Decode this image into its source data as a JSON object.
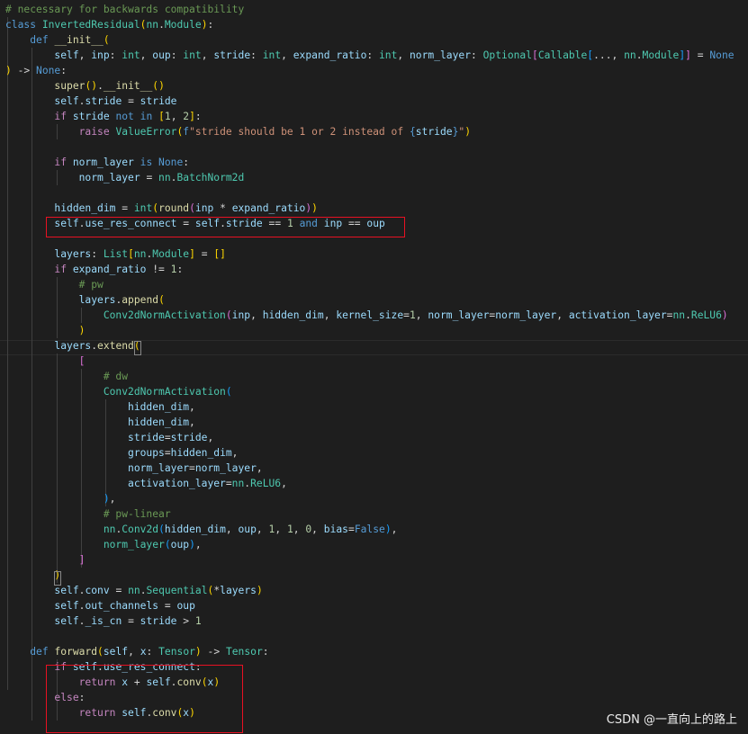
{
  "editor": {
    "colors": {
      "background": "#1e1e1e",
      "highlight_box": "#e81123",
      "keyword": "#569cd6",
      "control": "#c586c0",
      "function": "#dcdcaa",
      "class": "#4ec9b0",
      "variable": "#9cdcfe",
      "number": "#b5cea8",
      "string": "#ce9178",
      "comment": "#6a9955"
    },
    "lines": [
      [
        [
          "t-cmt",
          "# necessary for backwards compatibility"
        ]
      ],
      [
        [
          "t-kw",
          "class "
        ],
        [
          "t-cls",
          "InvertedResidual"
        ],
        [
          "t-p1",
          "("
        ],
        [
          "t-cls",
          "nn"
        ],
        [
          "t-op",
          "."
        ],
        [
          "t-cls",
          "Module"
        ],
        [
          "t-p1",
          ")"
        ],
        [
          "t-op",
          ":"
        ]
      ],
      [
        [
          "t-op",
          "    "
        ],
        [
          "t-kw",
          "def "
        ],
        [
          "t-fn",
          "__init__"
        ],
        [
          "t-p1",
          "("
        ]
      ],
      [
        [
          "t-op",
          "        "
        ],
        [
          "t-var",
          "self"
        ],
        [
          "t-op",
          ", "
        ],
        [
          "t-var",
          "inp"
        ],
        [
          "t-op",
          ": "
        ],
        [
          "t-cls",
          "int"
        ],
        [
          "t-op",
          ", "
        ],
        [
          "t-var",
          "oup"
        ],
        [
          "t-op",
          ": "
        ],
        [
          "t-cls",
          "int"
        ],
        [
          "t-op",
          ", "
        ],
        [
          "t-var",
          "stride"
        ],
        [
          "t-op",
          ": "
        ],
        [
          "t-cls",
          "int"
        ],
        [
          "t-op",
          ", "
        ],
        [
          "t-var",
          "expand_ratio"
        ],
        [
          "t-op",
          ": "
        ],
        [
          "t-cls",
          "int"
        ],
        [
          "t-op",
          ", "
        ],
        [
          "t-var",
          "norm_layer"
        ],
        [
          "t-op",
          ": "
        ],
        [
          "t-cls",
          "Optional"
        ],
        [
          "t-p2",
          "["
        ],
        [
          "t-cls",
          "Callable"
        ],
        [
          "t-p3",
          "["
        ],
        [
          "t-op",
          "..., "
        ],
        [
          "t-cls",
          "nn"
        ],
        [
          "t-op",
          "."
        ],
        [
          "t-cls",
          "Module"
        ],
        [
          "t-p3",
          "]"
        ],
        [
          "t-p2",
          "]"
        ],
        [
          "t-op",
          " = "
        ],
        [
          "t-kw",
          "None"
        ]
      ],
      [
        [
          "t-p1",
          ")"
        ],
        [
          "t-op",
          " -> "
        ],
        [
          "t-kw",
          "None"
        ],
        [
          "t-op",
          ":"
        ]
      ],
      [
        [
          "t-op",
          "        "
        ],
        [
          "t-fn",
          "super"
        ],
        [
          "t-p1",
          "("
        ],
        [
          "t-p1",
          ")"
        ],
        [
          "t-op",
          "."
        ],
        [
          "t-fn",
          "__init__"
        ],
        [
          "t-p1",
          "("
        ],
        [
          "t-p1",
          ")"
        ]
      ],
      [
        [
          "t-op",
          "        "
        ],
        [
          "t-var",
          "self"
        ],
        [
          "t-op",
          "."
        ],
        [
          "t-var",
          "stride"
        ],
        [
          "t-op",
          " = "
        ],
        [
          "t-var",
          "stride"
        ]
      ],
      [
        [
          "t-op",
          "        "
        ],
        [
          "t-ctl",
          "if "
        ],
        [
          "t-var",
          "stride"
        ],
        [
          "t-kw",
          " not in "
        ],
        [
          "t-p1",
          "["
        ],
        [
          "t-num",
          "1"
        ],
        [
          "t-op",
          ", "
        ],
        [
          "t-num",
          "2"
        ],
        [
          "t-p1",
          "]"
        ],
        [
          "t-op",
          ":"
        ]
      ],
      [
        [
          "t-op",
          "            "
        ],
        [
          "t-ctl",
          "raise "
        ],
        [
          "t-cls",
          "ValueError"
        ],
        [
          "t-p1",
          "("
        ],
        [
          "t-kw",
          "f"
        ],
        [
          "t-str",
          "\"stride should be 1 or 2 instead of "
        ],
        [
          "t-kw",
          "{"
        ],
        [
          "t-var",
          "stride"
        ],
        [
          "t-kw",
          "}"
        ],
        [
          "t-str",
          "\""
        ],
        [
          "t-p1",
          ")"
        ]
      ],
      [],
      [
        [
          "t-op",
          "        "
        ],
        [
          "t-ctl",
          "if "
        ],
        [
          "t-var",
          "norm_layer"
        ],
        [
          "t-kw",
          " is None"
        ],
        [
          "t-op",
          ":"
        ]
      ],
      [
        [
          "t-op",
          "            "
        ],
        [
          "t-var",
          "norm_layer"
        ],
        [
          "t-op",
          " = "
        ],
        [
          "t-cls",
          "nn"
        ],
        [
          "t-op",
          "."
        ],
        [
          "t-cls",
          "BatchNorm2d"
        ]
      ],
      [],
      [
        [
          "t-op",
          "        "
        ],
        [
          "t-var",
          "hidden_dim"
        ],
        [
          "t-op",
          " = "
        ],
        [
          "t-cls",
          "int"
        ],
        [
          "t-p1",
          "("
        ],
        [
          "t-fn",
          "round"
        ],
        [
          "t-p2",
          "("
        ],
        [
          "t-var",
          "inp"
        ],
        [
          "t-op",
          " * "
        ],
        [
          "t-var",
          "expand_ratio"
        ],
        [
          "t-p2",
          ")"
        ],
        [
          "t-p1",
          ")"
        ]
      ],
      [
        [
          "t-op",
          "        "
        ],
        [
          "t-var",
          "self"
        ],
        [
          "t-op",
          "."
        ],
        [
          "t-var",
          "use_res_connect"
        ],
        [
          "t-op",
          " = "
        ],
        [
          "t-var",
          "self"
        ],
        [
          "t-op",
          "."
        ],
        [
          "t-var",
          "stride"
        ],
        [
          "t-op",
          " == "
        ],
        [
          "t-num",
          "1"
        ],
        [
          "t-kw",
          " and "
        ],
        [
          "t-var",
          "inp"
        ],
        [
          "t-op",
          " == "
        ],
        [
          "t-var",
          "oup"
        ]
      ],
      [],
      [
        [
          "t-op",
          "        "
        ],
        [
          "t-var",
          "layers"
        ],
        [
          "t-op",
          ": "
        ],
        [
          "t-cls",
          "List"
        ],
        [
          "t-p1",
          "["
        ],
        [
          "t-cls",
          "nn"
        ],
        [
          "t-op",
          "."
        ],
        [
          "t-cls",
          "Module"
        ],
        [
          "t-p1",
          "]"
        ],
        [
          "t-op",
          " = "
        ],
        [
          "t-p1",
          "["
        ],
        [
          "t-p1",
          "]"
        ]
      ],
      [
        [
          "t-op",
          "        "
        ],
        [
          "t-ctl",
          "if "
        ],
        [
          "t-var",
          "expand_ratio"
        ],
        [
          "t-op",
          " != "
        ],
        [
          "t-num",
          "1"
        ],
        [
          "t-op",
          ":"
        ]
      ],
      [
        [
          "t-op",
          "            "
        ],
        [
          "t-cmt",
          "# pw"
        ]
      ],
      [
        [
          "t-op",
          "            "
        ],
        [
          "t-var",
          "layers"
        ],
        [
          "t-op",
          "."
        ],
        [
          "t-fn",
          "append"
        ],
        [
          "t-p1",
          "("
        ]
      ],
      [
        [
          "t-op",
          "                "
        ],
        [
          "t-cls",
          "Conv2dNormActivation"
        ],
        [
          "t-p2",
          "("
        ],
        [
          "t-var",
          "inp"
        ],
        [
          "t-op",
          ", "
        ],
        [
          "t-var",
          "hidden_dim"
        ],
        [
          "t-op",
          ", "
        ],
        [
          "t-var",
          "kernel_size"
        ],
        [
          "t-op",
          "="
        ],
        [
          "t-num",
          "1"
        ],
        [
          "t-op",
          ", "
        ],
        [
          "t-var",
          "norm_layer"
        ],
        [
          "t-op",
          "="
        ],
        [
          "t-var",
          "norm_layer"
        ],
        [
          "t-op",
          ", "
        ],
        [
          "t-var",
          "activation_layer"
        ],
        [
          "t-op",
          "="
        ],
        [
          "t-cls",
          "nn"
        ],
        [
          "t-op",
          "."
        ],
        [
          "t-cls",
          "ReLU6"
        ],
        [
          "t-p2",
          ")"
        ]
      ],
      [
        [
          "t-op",
          "            "
        ],
        [
          "t-p1",
          ")"
        ]
      ],
      [
        [
          "t-op",
          "        "
        ],
        [
          "t-var",
          "layers"
        ],
        [
          "t-op",
          "."
        ],
        [
          "t-fn",
          "extend"
        ],
        [
          "t-p1",
          "("
        ]
      ],
      [
        [
          "t-op",
          "            "
        ],
        [
          "t-p2",
          "["
        ]
      ],
      [
        [
          "t-op",
          "                "
        ],
        [
          "t-cmt",
          "# dw"
        ]
      ],
      [
        [
          "t-op",
          "                "
        ],
        [
          "t-cls",
          "Conv2dNormActivation"
        ],
        [
          "t-p3",
          "("
        ]
      ],
      [
        [
          "t-op",
          "                    "
        ],
        [
          "t-var",
          "hidden_dim"
        ],
        [
          "t-op",
          ","
        ]
      ],
      [
        [
          "t-op",
          "                    "
        ],
        [
          "t-var",
          "hidden_dim"
        ],
        [
          "t-op",
          ","
        ]
      ],
      [
        [
          "t-op",
          "                    "
        ],
        [
          "t-var",
          "stride"
        ],
        [
          "t-op",
          "="
        ],
        [
          "t-var",
          "stride"
        ],
        [
          "t-op",
          ","
        ]
      ],
      [
        [
          "t-op",
          "                    "
        ],
        [
          "t-var",
          "groups"
        ],
        [
          "t-op",
          "="
        ],
        [
          "t-var",
          "hidden_dim"
        ],
        [
          "t-op",
          ","
        ]
      ],
      [
        [
          "t-op",
          "                    "
        ],
        [
          "t-var",
          "norm_layer"
        ],
        [
          "t-op",
          "="
        ],
        [
          "t-var",
          "norm_layer"
        ],
        [
          "t-op",
          ","
        ]
      ],
      [
        [
          "t-op",
          "                    "
        ],
        [
          "t-var",
          "activation_layer"
        ],
        [
          "t-op",
          "="
        ],
        [
          "t-cls",
          "nn"
        ],
        [
          "t-op",
          "."
        ],
        [
          "t-cls",
          "ReLU6"
        ],
        [
          "t-op",
          ","
        ]
      ],
      [
        [
          "t-op",
          "                "
        ],
        [
          "t-p3",
          ")"
        ],
        [
          "t-op",
          ","
        ]
      ],
      [
        [
          "t-op",
          "                "
        ],
        [
          "t-cmt",
          "# pw-linear"
        ]
      ],
      [
        [
          "t-op",
          "                "
        ],
        [
          "t-cls",
          "nn"
        ],
        [
          "t-op",
          "."
        ],
        [
          "t-cls",
          "Conv2d"
        ],
        [
          "t-p3",
          "("
        ],
        [
          "t-var",
          "hidden_dim"
        ],
        [
          "t-op",
          ", "
        ],
        [
          "t-var",
          "oup"
        ],
        [
          "t-op",
          ", "
        ],
        [
          "t-num",
          "1"
        ],
        [
          "t-op",
          ", "
        ],
        [
          "t-num",
          "1"
        ],
        [
          "t-op",
          ", "
        ],
        [
          "t-num",
          "0"
        ],
        [
          "t-op",
          ", "
        ],
        [
          "t-var",
          "bias"
        ],
        [
          "t-op",
          "="
        ],
        [
          "t-kw",
          "False"
        ],
        [
          "t-p3",
          ")"
        ],
        [
          "t-op",
          ","
        ]
      ],
      [
        [
          "t-op",
          "                "
        ],
        [
          "t-cls",
          "norm_layer"
        ],
        [
          "t-p3",
          "("
        ],
        [
          "t-var",
          "oup"
        ],
        [
          "t-p3",
          ")"
        ],
        [
          "t-op",
          ","
        ]
      ],
      [
        [
          "t-op",
          "            "
        ],
        [
          "t-p2",
          "]"
        ]
      ],
      [
        [
          "t-op",
          "        "
        ],
        [
          "t-p1",
          ")"
        ]
      ],
      [
        [
          "t-op",
          "        "
        ],
        [
          "t-var",
          "self"
        ],
        [
          "t-op",
          "."
        ],
        [
          "t-var",
          "conv"
        ],
        [
          "t-op",
          " = "
        ],
        [
          "t-cls",
          "nn"
        ],
        [
          "t-op",
          "."
        ],
        [
          "t-cls",
          "Sequential"
        ],
        [
          "t-p1",
          "("
        ],
        [
          "t-op",
          "*"
        ],
        [
          "t-var",
          "layers"
        ],
        [
          "t-p1",
          ")"
        ]
      ],
      [
        [
          "t-op",
          "        "
        ],
        [
          "t-var",
          "self"
        ],
        [
          "t-op",
          "."
        ],
        [
          "t-var",
          "out_channels"
        ],
        [
          "t-op",
          " = "
        ],
        [
          "t-var",
          "oup"
        ]
      ],
      [
        [
          "t-op",
          "        "
        ],
        [
          "t-var",
          "self"
        ],
        [
          "t-op",
          "."
        ],
        [
          "t-var",
          "_is_cn"
        ],
        [
          "t-op",
          " = "
        ],
        [
          "t-var",
          "stride"
        ],
        [
          "t-op",
          " > "
        ],
        [
          "t-num",
          "1"
        ]
      ],
      [],
      [
        [
          "t-op",
          "    "
        ],
        [
          "t-kw",
          "def "
        ],
        [
          "t-fn",
          "forward"
        ],
        [
          "t-p1",
          "("
        ],
        [
          "t-var",
          "self"
        ],
        [
          "t-op",
          ", "
        ],
        [
          "t-var",
          "x"
        ],
        [
          "t-op",
          ": "
        ],
        [
          "t-cls",
          "Tensor"
        ],
        [
          "t-p1",
          ")"
        ],
        [
          "t-op",
          " -> "
        ],
        [
          "t-cls",
          "Tensor"
        ],
        [
          "t-op",
          ":"
        ]
      ],
      [
        [
          "t-op",
          "        "
        ],
        [
          "t-ctl",
          "if "
        ],
        [
          "t-var",
          "self"
        ],
        [
          "t-op",
          "."
        ],
        [
          "t-var",
          "use_res_connect"
        ],
        [
          "t-op",
          ":"
        ]
      ],
      [
        [
          "t-op",
          "            "
        ],
        [
          "t-ctl",
          "return "
        ],
        [
          "t-var",
          "x"
        ],
        [
          "t-op",
          " + "
        ],
        [
          "t-var",
          "self"
        ],
        [
          "t-op",
          "."
        ],
        [
          "t-fn",
          "conv"
        ],
        [
          "t-p1",
          "("
        ],
        [
          "t-var",
          "x"
        ],
        [
          "t-p1",
          ")"
        ]
      ],
      [
        [
          "t-op",
          "        "
        ],
        [
          "t-ctl",
          "else"
        ],
        [
          "t-op",
          ":"
        ]
      ],
      [
        [
          "t-op",
          "            "
        ],
        [
          "t-ctl",
          "return "
        ],
        [
          "t-var",
          "self"
        ],
        [
          "t-op",
          "."
        ],
        [
          "t-fn",
          "conv"
        ],
        [
          "t-p1",
          "("
        ],
        [
          "t-var",
          "x"
        ],
        [
          "t-p1",
          ")"
        ]
      ]
    ]
  },
  "watermark": {
    "text": "CSDN @一直向上的路上"
  }
}
